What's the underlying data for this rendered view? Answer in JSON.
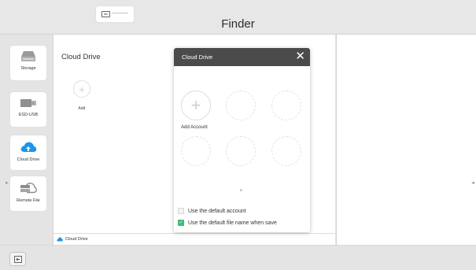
{
  "window": {
    "title": "Finder"
  },
  "tab_chip": {
    "box_text": "lbs",
    "dots_text": "--------"
  },
  "sidebar": {
    "items": [
      {
        "label": "Storage",
        "icon": "hard-drive-icon"
      },
      {
        "label": "ESD-USB",
        "icon": "usb-drive-icon"
      },
      {
        "label": "Cloud Drive",
        "icon": "cloud-upload-icon",
        "selected": true
      },
      {
        "label": "Remote File",
        "icon": "remote-file-icon"
      }
    ]
  },
  "main": {
    "title": "Cloud Drive",
    "add_label": "Add"
  },
  "statusbar": {
    "path": "Cloud Drive"
  },
  "dialog": {
    "title": "Cloud Drive",
    "add_account_label": "Add Account",
    "options": [
      {
        "label": "Use the default account",
        "checked": false
      },
      {
        "label": "Use the default file name when save",
        "checked": true
      }
    ]
  },
  "colors": {
    "accent": "#3dbc77",
    "cloud_blue": "#1e95e8",
    "dialog_header": "#4b4b4b"
  }
}
